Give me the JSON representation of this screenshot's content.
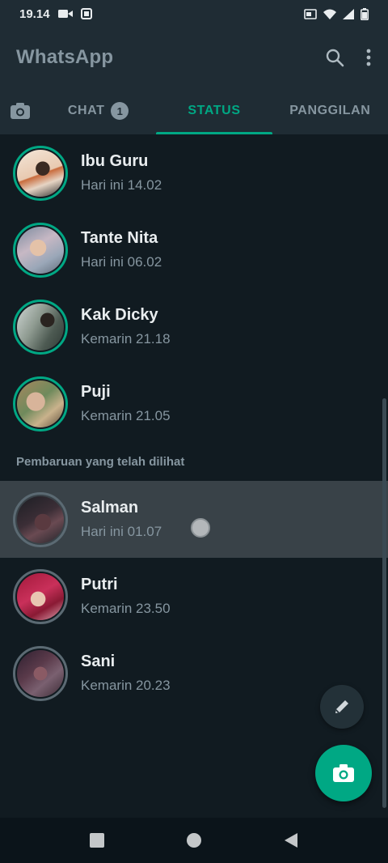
{
  "status_bar": {
    "time": "19.14"
  },
  "app": {
    "title": "WhatsApp"
  },
  "tabs": [
    {
      "label": "CHAT",
      "badge": "1"
    },
    {
      "label": "STATUS"
    },
    {
      "label": "PANGGILAN"
    }
  ],
  "recent_updates": [
    {
      "name": "Ibu Guru",
      "time": "Hari ini 14.02"
    },
    {
      "name": "Tante Nita",
      "time": "Hari ini 06.02"
    },
    {
      "name": "Kak Dicky",
      "time": "Kemarin 21.18"
    },
    {
      "name": "Puji",
      "time": "Kemarin 21.05"
    }
  ],
  "viewed_section_label": "Pembaruan yang telah dilihat",
  "viewed_updates": [
    {
      "name": "Salman",
      "time": "Hari ini 01.07"
    },
    {
      "name": "Putri",
      "time": "Kemarin 23.50"
    },
    {
      "name": "Sani",
      "time": "Kemarin 20.23"
    }
  ],
  "colors": {
    "accent": "#00a884",
    "background": "#111b21",
    "header": "#1f2c34"
  }
}
